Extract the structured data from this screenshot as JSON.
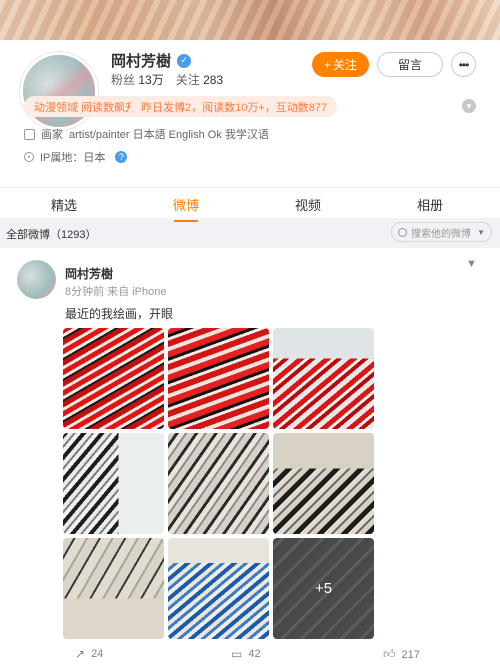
{
  "profile": {
    "name": "岡村芳樹",
    "verified_glyph": "✓",
    "stats": {
      "fans_label": "粉丝",
      "fans_value": "13万",
      "following_label": "关注",
      "following_value": "283"
    },
    "follow_button": "关注",
    "follow_plus": "+",
    "message_button": "留言",
    "more_glyph": "•••",
    "tags": [
      "动漫领域 阅读数飙升",
      "昨日发博2，阅读数10万+，互动数877"
    ],
    "info": {
      "bio_label": "画家",
      "bio_text": "artist/painter 日本語 English Ok 我学汉语",
      "ip_text": "IP属地：日本"
    }
  },
  "tabs": [
    "精选",
    "微博",
    "视频",
    "相册"
  ],
  "active_tab": "微博",
  "filter": {
    "all_posts": "全部微博（1293）",
    "search_placeholder": "搜索他的微博"
  },
  "post": {
    "author": "岡村芳樹",
    "meta": "8分钟前  来自 iPhone",
    "text": "最近的我绘画，开眼",
    "more_images": "+5",
    "actions": {
      "repost": "24",
      "comment": "42",
      "like": "217"
    }
  },
  "colors": {
    "accent": "#ff8200",
    "tag_bg": "#fdece3",
    "tag_text": "#ff7a3d",
    "verified": "#4a9de8"
  }
}
